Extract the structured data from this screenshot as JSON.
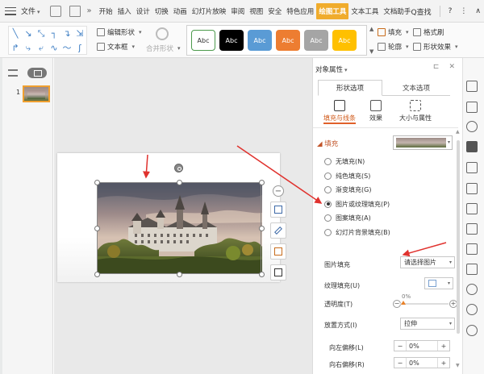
{
  "menubar": {
    "file_label": "文件",
    "items": [
      "开始",
      "插入",
      "设计",
      "切换",
      "动画",
      "幻灯片放映",
      "审阅",
      "视图",
      "安全",
      "特色应用",
      "绘图工具",
      "文本工具",
      "文档助手"
    ],
    "active_item": "绘图工具",
    "search_label": "Q查找",
    "help_label": "?",
    "more_label": "⋮",
    "collapse_label": "∧"
  },
  "ribbon": {
    "edit_shape_label": "编辑形状",
    "text_box_label": "文本框",
    "merge_shape_label": "合并形状",
    "style_swatches": [
      {
        "text": "Abc",
        "bg": "#ffffff",
        "fg": "#333333",
        "border": "#4c9a4c"
      },
      {
        "text": "Abc",
        "bg": "#000000",
        "fg": "#ffffff",
        "border": "#000000"
      },
      {
        "text": "Abc",
        "bg": "#5a9bd5",
        "fg": "#ffffff",
        "border": "#5a9bd5"
      },
      {
        "text": "Abc",
        "bg": "#ed7d31",
        "fg": "#ffffff",
        "border": "#ed7d31"
      },
      {
        "text": "Abc",
        "bg": "#a5a5a5",
        "fg": "#ffffff",
        "border": "#a5a5a5"
      },
      {
        "text": "Abc",
        "bg": "#ffc000",
        "fg": "#ffffff",
        "border": "#ffc000"
      }
    ],
    "fill_label": "填充",
    "format_brush_label": "格式刷",
    "outline_label": "轮廓",
    "shape_effect_label": "形状效果"
  },
  "thumbnails": {
    "slide_number": "1"
  },
  "properties": {
    "title": "对象属性",
    "tab_shape": "形状选项",
    "tab_text": "文本选项",
    "subtab_fill_line": "填充与线条",
    "subtab_effect": "效果",
    "subtab_size": "大小与属性",
    "fill_section": "填充",
    "fill_options": [
      "无填充(N)",
      "纯色填充(S)",
      "渐变填充(G)",
      "图片或纹理填充(P)",
      "图案填充(A)",
      "幻灯片背景填充(B)"
    ],
    "selected_fill": "图片或纹理填充(P)",
    "picture_fill_label": "图片填充",
    "picture_fill_value": "请选择图片",
    "texture_fill_label": "纹理填充(U)",
    "transparency_label": "透明度(T)",
    "transparency_value": "0%",
    "placement_label": "放置方式(I)",
    "placement_value": "拉伸",
    "offset_left_label": "向左偏移(L)",
    "offset_left_value": "0%",
    "offset_right_label": "向右偏移(R)",
    "offset_right_value": "0%"
  },
  "colors": {
    "accent_orange": "#f0ac2c",
    "annotation_red": "#e0322e",
    "active_text": "#d05a1a"
  }
}
